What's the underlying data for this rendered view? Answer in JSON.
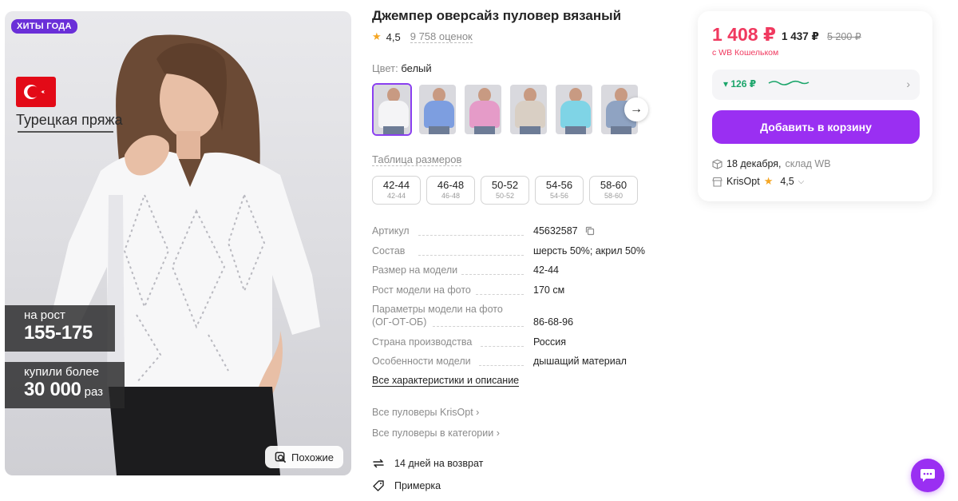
{
  "hero": {
    "badge": "ХИТЫ ГОДА",
    "yarn_text": "Турецкая пряжа",
    "promo1_small": "на рост",
    "promo1_big": "155-175",
    "promo2_small": "купили более",
    "promo2_big": "30 000",
    "promo2_unit": "раз",
    "similar_label": "Похожие"
  },
  "product": {
    "title": "Джемпер оверсайз пуловер вязаный",
    "rating": "4,5",
    "reviews": "9 758 оценок",
    "color_label": "Цвет:",
    "color_value": "белый",
    "thumbs": [
      {
        "color": "#f4f4f6"
      },
      {
        "color": "#7d9ee0"
      },
      {
        "color": "#e59bc8"
      },
      {
        "color": "#d9cfc4"
      },
      {
        "color": "#7fd4e6"
      },
      {
        "color": "#8fa3c2"
      }
    ],
    "size_table": "Таблица размеров",
    "sizes": [
      {
        "label": "42-44",
        "sub": "42-44"
      },
      {
        "label": "46-48",
        "sub": "46-48"
      },
      {
        "label": "50-52",
        "sub": "50-52"
      },
      {
        "label": "54-56",
        "sub": "54-56"
      },
      {
        "label": "58-60",
        "sub": "58-60"
      }
    ]
  },
  "specs": [
    {
      "k": "Артикул",
      "v": "45632587"
    },
    {
      "k": "Состав",
      "v": "шерсть 50%; акрил 50%"
    },
    {
      "k": "Размер на модели",
      "v": "42-44"
    },
    {
      "k": "Рост модели на фото",
      "v": "170 см"
    },
    {
      "k": "Параметры модели на фото",
      "k2": "(ОГ-ОТ-ОБ)",
      "v": "86-68-96"
    },
    {
      "k": "Страна производства",
      "v": "Россия"
    },
    {
      "k": "Особенности модели",
      "v": "дышащий материал"
    }
  ],
  "links": {
    "all_chars": "Все характеристики и описание",
    "brand_link": "Все пуловеры KrisOpt",
    "category_link": "Все пуловеры в категории",
    "return": "14 дней на возврат",
    "fitting": "Примерка"
  },
  "card": {
    "price": "1 408 ₽",
    "price_alt": "1 437 ₽",
    "price_old": "5 200 ₽",
    "wallet_note": "с WB Кошельком",
    "cashback": "126 ₽",
    "add_to_cart": "Добавить в корзину",
    "delivery_date": "18 декабря,",
    "delivery_wh": "склад WB",
    "seller": "KrisOpt",
    "seller_rating": "4,5"
  },
  "colors": {
    "accent": "#9a2ff2",
    "price": "#f0395f",
    "cashback": "#1ba56a",
    "badge": "#6a2fd8"
  }
}
